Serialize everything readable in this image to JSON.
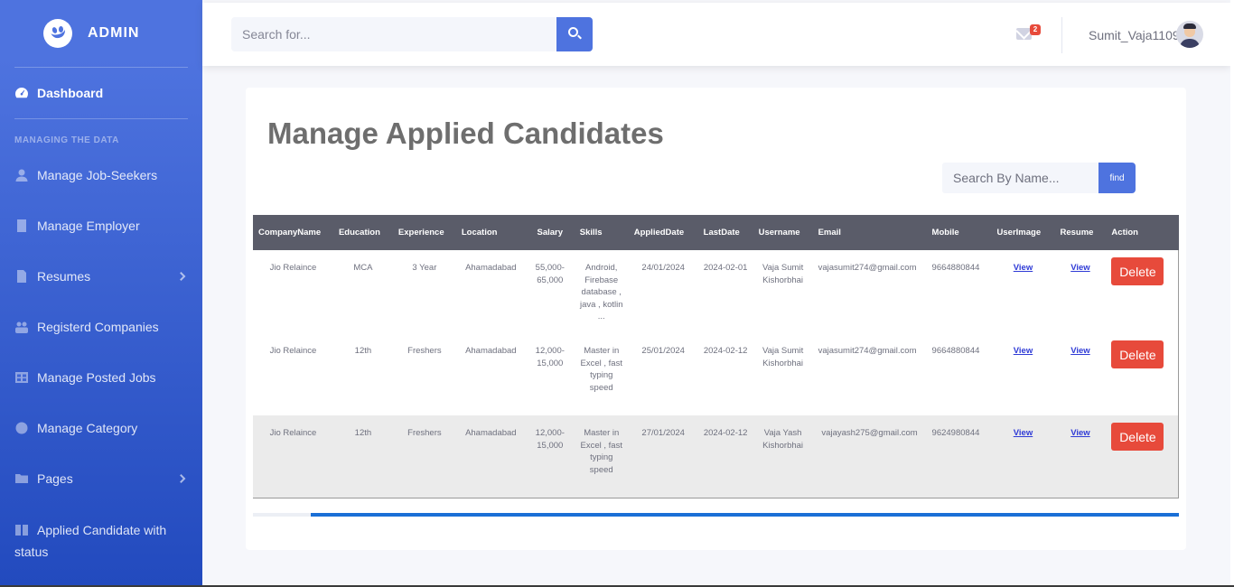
{
  "brand": {
    "name": "ADMIN",
    "icon": "laugh-wink-icon"
  },
  "sidebar": {
    "dashboard": "Dashboard",
    "heading": "MANAGING THE DATA",
    "items": [
      {
        "label": "Manage Job-Seekers",
        "icon": "user-icon"
      },
      {
        "label": "Manage Employer",
        "icon": "building-icon"
      },
      {
        "label": "Resumes",
        "icon": "file-icon"
      },
      {
        "label": "Registerd Companies",
        "icon": "users-icon"
      },
      {
        "label": "Manage Posted Jobs",
        "icon": "table-icon"
      },
      {
        "label": "Manage Category",
        "icon": "globe-icon"
      },
      {
        "label": "Pages",
        "icon": "folder-icon"
      },
      {
        "label": "Applied Candidate with status",
        "icon": "book-icon"
      }
    ]
  },
  "topbar": {
    "search_placeholder": "Search for...",
    "mail_badge": "2",
    "username": "Sumit_Vaja1109"
  },
  "main": {
    "title": "Manage Applied Candidates",
    "name_search_placeholder": "Search By Name...",
    "find_label": "find",
    "columns": [
      "CompanyName",
      "Education",
      "Experience",
      "Location",
      "Salary",
      "Skills",
      "AppliedDate",
      "LastDate",
      "Username",
      "Email",
      "Mobile",
      "UserImage",
      "Resume",
      "Action"
    ],
    "rows": [
      {
        "company": "Jio Relaince",
        "education": "MCA",
        "experience": "3 Year",
        "location": "Ahamadabad",
        "salary": "55,000-65,000",
        "skills": "Android, Firebase database , java , kotlin ...",
        "applied": "24/01/2024",
        "last": "2024-02-01",
        "username": "Vaja Sumit Kishorbhai",
        "email": "vajasumit274@gmail.com",
        "mobile": "9664880844",
        "userimage": "View",
        "resume": "View",
        "action": "Delete"
      },
      {
        "company": "Jio Relaince",
        "education": "12th",
        "experience": "Freshers",
        "location": "Ahamadabad",
        "salary": "12,000-15,000",
        "skills": "Master in Excel , fast typing speed",
        "applied": "25/01/2024",
        "last": "2024-02-12",
        "username": "Vaja Sumit Kishorbhai",
        "email": "vajasumit274@gmail.com",
        "mobile": "9664880844",
        "userimage": "View",
        "resume": "View",
        "action": "Delete"
      },
      {
        "company": "Jio Relaince",
        "education": "12th",
        "experience": "Freshers",
        "location": "Ahamadabad",
        "salary": "12,000-15,000",
        "skills": "Master in Excel , fast typing speed",
        "applied": "27/01/2024",
        "last": "2024-02-12",
        "username": "Vaja Yash Kishorbhai",
        "email": "vajayash275@gmail.com",
        "mobile": "9624980844",
        "userimage": "View",
        "resume": "View",
        "action": "Delete"
      }
    ]
  },
  "colors": {
    "primary": "#4e73df",
    "danger": "#e74a3b",
    "header_row": "#5a5c69",
    "scroll_thumb": "#1a6fd6"
  }
}
